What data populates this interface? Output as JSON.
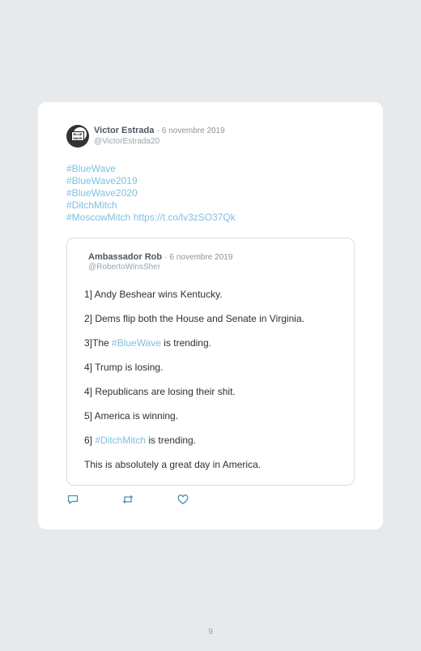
{
  "tweet": {
    "author": {
      "name": "Victor Estrada",
      "separator": "·",
      "date": "6 novembre 2019",
      "handle": "@VictorEstrada20",
      "avatar_text": "BLUE WAVE"
    },
    "hashtags": [
      "#BlueWave",
      "#BlueWave2019",
      "#BlueWave2020",
      "#DitchMitch"
    ],
    "last_line_hashtag": "#MoscowMitch",
    "link": "https://t.co/lv3zSO37Qk",
    "quoted": {
      "name": "Ambassador Rob",
      "separator": "·",
      "date": "6 novembre 2019",
      "handle": "@RobertoWinsSher",
      "lines": {
        "l1": "1] Andy Beshear wins Kentucky.",
        "l2": "2] Dems flip both the House and Senate in Virginia.",
        "l3_prefix": "3]The ",
        "l3_tag": "#BlueWave",
        "l3_suffix": " is trending.",
        "l4a": "4] Trump is losing.",
        "l4b": "4] Republicans are losing their shit.",
        "l5": "5] America is winning.",
        "l6_prefix": "6] ",
        "l6_tag": "#DitchMitch",
        "l6_suffix": " is trending.",
        "l7": "This is absolutely a great day in America."
      }
    },
    "actions": {
      "reply_icon": "reply-icon",
      "retweet_icon": "retweet-icon",
      "like_icon": "heart-icon"
    }
  },
  "page": {
    "number": "9"
  },
  "colors": {
    "background": "#e6eaec",
    "card": "#ffffff",
    "link": "#7dc1e0",
    "icon": "#4a8fb4"
  }
}
